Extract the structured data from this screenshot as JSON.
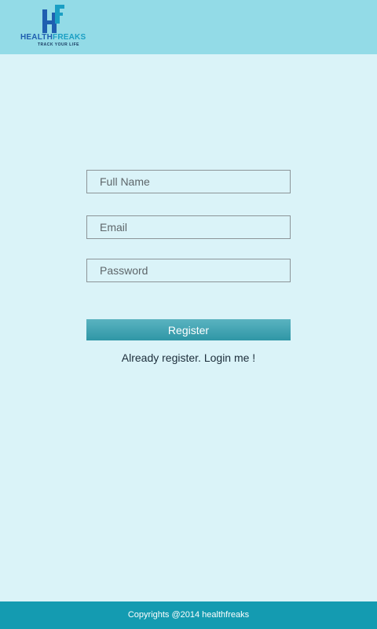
{
  "header": {
    "logo": {
      "monogram": "HF",
      "word_part1": "HEALTH",
      "word_part2": "FREAKS",
      "tagline": "TRACK YOUR LIFE"
    }
  },
  "form": {
    "full_name": {
      "placeholder": "Full Name",
      "value": ""
    },
    "email": {
      "placeholder": "Email",
      "value": ""
    },
    "password": {
      "placeholder": "Password",
      "value": ""
    },
    "register_label": "Register",
    "login_link": "Already register. Login me !"
  },
  "footer": {
    "copyright": "Copyrights @2014 healthfreaks"
  },
  "colors": {
    "header_bg": "#93dbe7",
    "page_bg": "#daf3f8",
    "button": "#3a9fae",
    "footer_bg": "#149bb1",
    "logo_blue": "#1f5fb0",
    "logo_teal": "#1b9fc4"
  }
}
